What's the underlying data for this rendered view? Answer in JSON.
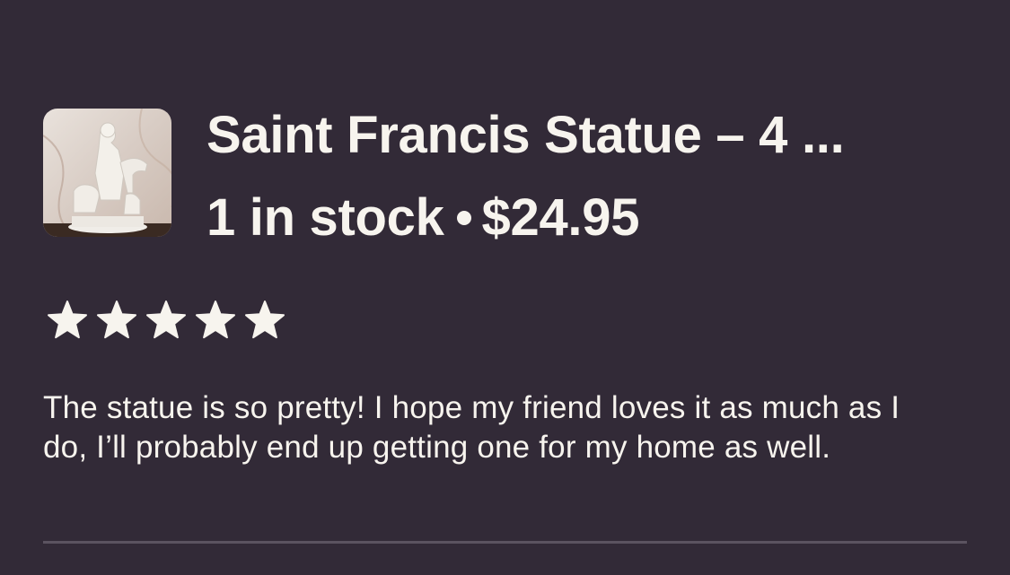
{
  "product": {
    "title": "Saint Francis Statue –  4 ...",
    "stock": "1 in stock",
    "price": "$24.95",
    "thumbnail_icon": "statue-thumbnail"
  },
  "review": {
    "rating": 5,
    "rating_max": 5,
    "text": "The statue is so pretty! I hope my friend loves it as much as I do, I’ll probably end up getting one for my home as well."
  },
  "colors": {
    "background": "#322a37",
    "text": "#f7f4ee",
    "divider": "#5b5360"
  }
}
